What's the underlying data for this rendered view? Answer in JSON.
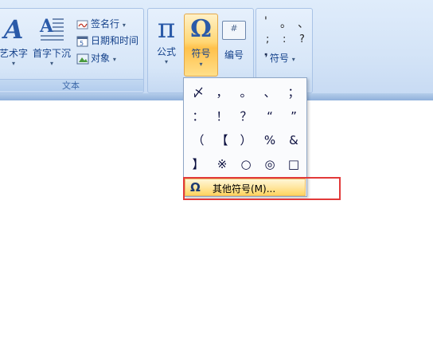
{
  "ribbon": {
    "text_group": {
      "label": "文本",
      "wordart": "艺术字",
      "dropcap": "首字下沉",
      "signature_line": "签名行",
      "date_time": "日期和时间",
      "object": "对象"
    },
    "symbols_group": {
      "equation": "公式",
      "symbol": "符号",
      "number": "编号"
    },
    "special_symbols_group": {
      "symbol_menu": "符号",
      "row1": [
        "'",
        "。",
        "、"
      ],
      "row2": [
        ";",
        ":",
        "?"
      ]
    },
    "icons": {
      "equation": "π",
      "symbol": "Ω",
      "number": "#",
      "wordart": "A",
      "quote": "❜"
    }
  },
  "symbol_dropdown": {
    "symbols": [
      "〆",
      "，",
      "。",
      "、",
      "；",
      "：",
      "！",
      "？",
      "“",
      "”",
      "（",
      "【",
      "）",
      "%",
      "&",
      "】",
      "※",
      "○",
      "◎",
      "□"
    ],
    "more_label": "其他符号(M)...",
    "more_icon": "Ω"
  },
  "colors": {
    "ribbon": "#dfecfb",
    "highlight": "#ffd775",
    "red_box": "#e23a3a"
  }
}
